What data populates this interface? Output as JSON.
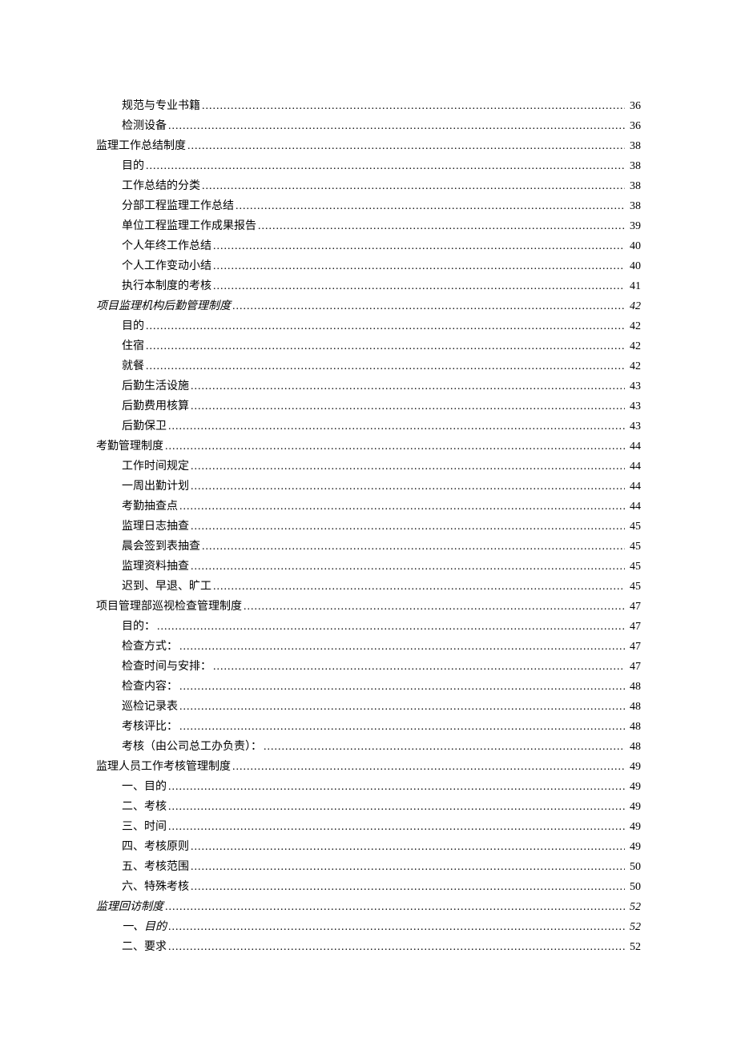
{
  "toc": [
    {
      "level": 2,
      "label": "规范与专业书籍",
      "page": "36",
      "italic": false
    },
    {
      "level": 2,
      "label": "检测设备",
      "page": "36",
      "italic": false
    },
    {
      "level": 1,
      "label": "监理工作总结制度",
      "page": "38",
      "italic": false
    },
    {
      "level": 2,
      "label": "目的",
      "page": "38",
      "italic": false
    },
    {
      "level": 2,
      "label": "工作总结的分类",
      "page": "38",
      "italic": false
    },
    {
      "level": 2,
      "label": "分部工程监理工作总结",
      "page": "38",
      "italic": false
    },
    {
      "level": 2,
      "label": "单位工程监理工作成果报告",
      "page": "39",
      "italic": false
    },
    {
      "level": 2,
      "label": "个人年终工作总结",
      "page": "40",
      "italic": false
    },
    {
      "level": 2,
      "label": "个人工作变动小结",
      "page": "40",
      "italic": false
    },
    {
      "level": 2,
      "label": "执行本制度的考核",
      "page": "41",
      "italic": false
    },
    {
      "level": 1,
      "label": "项目监理机构后勤管理制度",
      "page": "42",
      "italic": true
    },
    {
      "level": 2,
      "label": "目的",
      "page": "42",
      "italic": false
    },
    {
      "level": 2,
      "label": "住宿",
      "page": "42",
      "italic": false
    },
    {
      "level": 2,
      "label": "就餐",
      "page": "42",
      "italic": false
    },
    {
      "level": 2,
      "label": "后勤生活设施",
      "page": "43",
      "italic": false
    },
    {
      "level": 2,
      "label": "后勤费用核算",
      "page": "43",
      "italic": false
    },
    {
      "level": 2,
      "label": "后勤保卫",
      "page": "43",
      "italic": false
    },
    {
      "level": 1,
      "label": "考勤管理制度",
      "page": "44",
      "italic": false
    },
    {
      "level": 2,
      "label": "工作时间规定",
      "page": "44",
      "italic": false
    },
    {
      "level": 2,
      "label": "一周出勤计划",
      "page": "44",
      "italic": false
    },
    {
      "level": 2,
      "label": "考勤抽查点",
      "page": "44",
      "italic": false
    },
    {
      "level": 2,
      "label": "监理日志抽查",
      "page": "45",
      "italic": false
    },
    {
      "level": 2,
      "label": "晨会签到表抽查",
      "page": "45",
      "italic": false
    },
    {
      "level": 2,
      "label": "监理资料抽查",
      "page": "45",
      "italic": false
    },
    {
      "level": 2,
      "label": "迟到、早退、旷工",
      "page": "45",
      "italic": false
    },
    {
      "level": 1,
      "label": "项目管理部巡视检查管理制度",
      "page": "47",
      "italic": false
    },
    {
      "level": 2,
      "label": "目的：",
      "page": "47",
      "italic": false
    },
    {
      "level": 2,
      "label": "检查方式：",
      "page": "47",
      "italic": false
    },
    {
      "level": 2,
      "label": "检查时间与安排：",
      "page": "47",
      "italic": false
    },
    {
      "level": 2,
      "label": "检查内容：",
      "page": "48",
      "italic": false
    },
    {
      "level": 2,
      "label": "巡检记录表",
      "page": "48",
      "italic": false
    },
    {
      "level": 2,
      "label": "考核评比：",
      "page": "48",
      "italic": false
    },
    {
      "level": 2,
      "label": "考核（由公司总工办负责）：",
      "page": "48",
      "italic": false
    },
    {
      "level": 1,
      "label": "监理人员工作考核管理制度",
      "page": "49",
      "italic": false
    },
    {
      "level": 2,
      "label": "一、目的",
      "page": "49",
      "italic": false
    },
    {
      "level": 2,
      "label": "二、考核",
      "page": "49",
      "italic": false
    },
    {
      "level": 2,
      "label": "三、时间",
      "page": "49",
      "italic": false
    },
    {
      "level": 2,
      "label": "四、考核原则",
      "page": "49",
      "italic": false
    },
    {
      "level": 2,
      "label": "五、考核范围",
      "page": "50",
      "italic": false
    },
    {
      "level": 2,
      "label": "六、特殊考核",
      "page": "50",
      "italic": false
    },
    {
      "level": 1,
      "label": "监理回访制度",
      "page": "52",
      "italic": true
    },
    {
      "level": 2,
      "label": "一、目的",
      "page": "52",
      "italic": true
    },
    {
      "level": 2,
      "label": "二、要求",
      "page": "52",
      "italic": false
    }
  ]
}
